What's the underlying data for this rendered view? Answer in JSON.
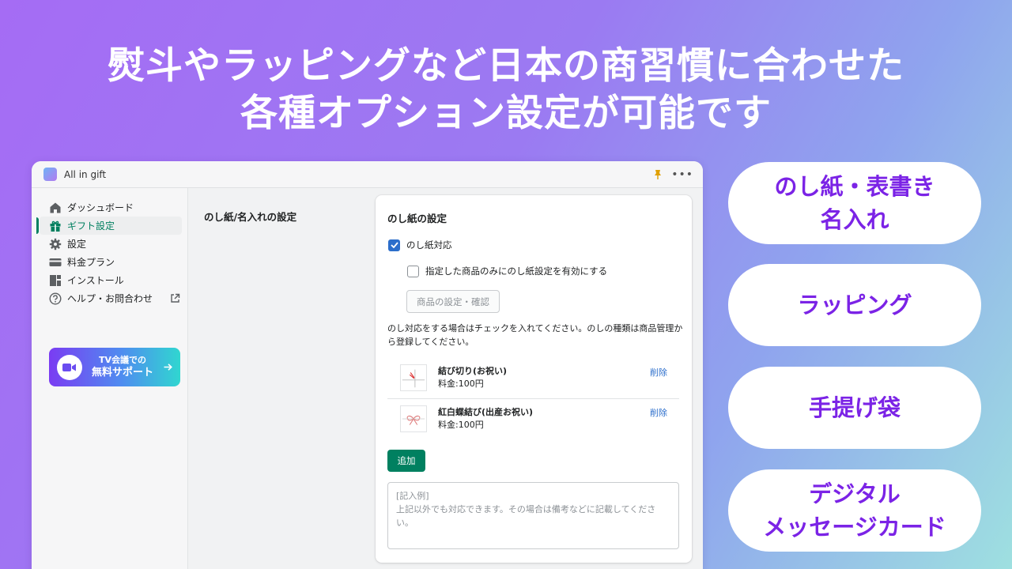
{
  "headline": {
    "line1": "熨斗やラッピングなど日本の商習慣に合わせた",
    "line2": "各種オプション設定が可能です"
  },
  "app": {
    "title": "All in gift",
    "more": "•••"
  },
  "sidebar": {
    "items": [
      {
        "label": "ダッシュボード",
        "icon": "home-icon"
      },
      {
        "label": "ギフト設定",
        "icon": "gift-icon",
        "active": true
      },
      {
        "label": "設定",
        "icon": "gear-icon"
      },
      {
        "label": "料金プラン",
        "icon": "card-icon"
      },
      {
        "label": "インストール",
        "icon": "apps-icon"
      },
      {
        "label": "ヘルプ・お問合わせ",
        "icon": "help-icon"
      }
    ],
    "support": {
      "small": "TV会議での",
      "big": "無料サポート",
      "arrow": "→"
    }
  },
  "main": {
    "section_title": "のし紙/名入れの設定",
    "card": {
      "title": "のし紙の設定",
      "checkbox1": {
        "label": "のし紙対応",
        "checked": true
      },
      "checkbox2": {
        "label": "指定した商品のみにのし紙設定を有効にする",
        "checked": false
      },
      "product_button": "商品の設定・確認",
      "help_text": "のし対応をする場合はチェックを入れてください。のしの種類は商品管理から登録してください。",
      "items": [
        {
          "name": "結び切り(お祝い)",
          "price": "料金:100円",
          "delete": "削除"
        },
        {
          "name": "紅白蝶結び(出産お祝い)",
          "price": "料金:100円",
          "delete": "削除"
        }
      ],
      "add_button": "追加",
      "textarea_value": "[記入例]\n上記以外でも対応できます。その場合は備考などに記載してください。"
    }
  },
  "features": [
    {
      "line1": "のし紙・表書き",
      "line2": "名入れ"
    },
    {
      "line1": "ラッピング",
      "line2": ""
    },
    {
      "line1": "手提げ袋",
      "line2": ""
    },
    {
      "line1": "デジタル",
      "line2": "メッセージカード"
    }
  ],
  "colors": {
    "accent": "#7b23e6",
    "primary_button": "#008060",
    "link": "#2c6ecb"
  }
}
